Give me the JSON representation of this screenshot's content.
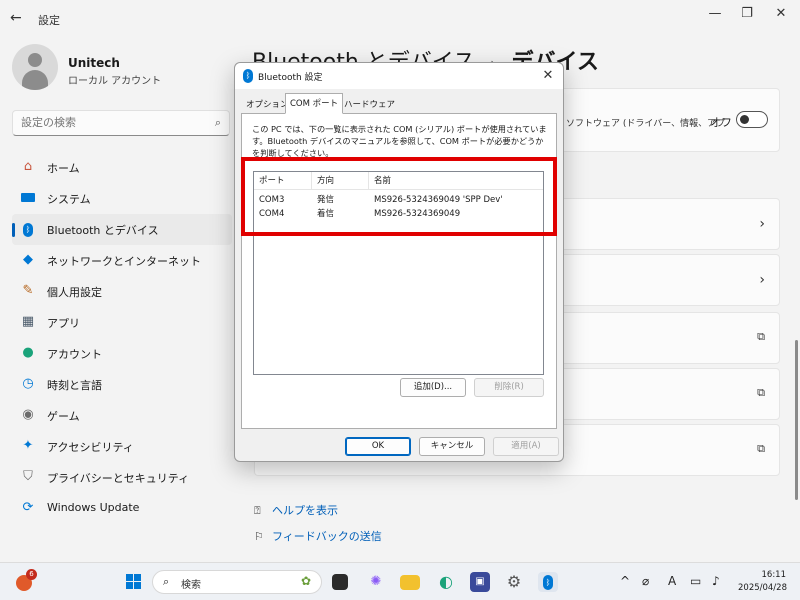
{
  "settings": {
    "app_title": "設定",
    "user": {
      "name": "Unitech",
      "account_type": "ローカル アカウント"
    },
    "search": {
      "placeholder": "設定の検索"
    },
    "nav": [
      {
        "label": "ホーム",
        "icon": "home-icon"
      },
      {
        "label": "システム",
        "icon": "system-icon"
      },
      {
        "label": "Bluetooth とデバイス",
        "icon": "bluetooth-icon"
      },
      {
        "label": "ネットワークとインターネット",
        "icon": "wifi-icon"
      },
      {
        "label": "個人用設定",
        "icon": "brush-icon"
      },
      {
        "label": "アプリ",
        "icon": "apps-icon"
      },
      {
        "label": "アカウント",
        "icon": "person-icon"
      },
      {
        "label": "時刻と言語",
        "icon": "globe-clock-icon"
      },
      {
        "label": "ゲーム",
        "icon": "gamepad-icon"
      },
      {
        "label": "アクセシビリティ",
        "icon": "accessibility-icon"
      },
      {
        "label": "プライバシーとセキュリティ",
        "icon": "shield-icon"
      },
      {
        "label": "Windows Update",
        "icon": "update-icon"
      }
    ],
    "active_nav_index": 2,
    "breadcrumb": {
      "parent": "Bluetooth とデバイス",
      "separator": "›",
      "current": "デバイス"
    },
    "toggle_row": {
      "text": "ソフトウェア (ドライバー、情報、アプ",
      "state_label": "オフ"
    },
    "links": {
      "help": "ヘルプを表示",
      "feedback": "フィードバックの送信"
    },
    "accent_color": "#005fb8"
  },
  "dialog": {
    "title": "Bluetooth 設定",
    "tabs": [
      "オプション",
      "COM ポート",
      "ハードウェア"
    ],
    "active_tab": 1,
    "description": "この PC では、下の一覧に表示された COM (シリアル) ポートが使用されています。Bluetooth デバイスのマニュアルを参照して、COM ポートが必要かどうかを判断してください。",
    "columns": [
      "ポート",
      "方向",
      "名前"
    ],
    "rows": [
      {
        "port": "COM3",
        "direction": "発信",
        "name": "MS926-5324369049 'SPP Dev'"
      },
      {
        "port": "COM4",
        "direction": "着信",
        "name": "MS926-5324369049"
      }
    ],
    "buttons": {
      "add": "追加(D)...",
      "remove": "削除(R)",
      "ok": "OK",
      "cancel": "キャンセル",
      "apply": "適用(A)"
    },
    "highlight_color": "#e00000"
  },
  "taskbar": {
    "weather_badge": "6",
    "search_placeholder": "検索",
    "ime_indicator": "A",
    "time": "16:11",
    "date": "2025/04/28"
  }
}
